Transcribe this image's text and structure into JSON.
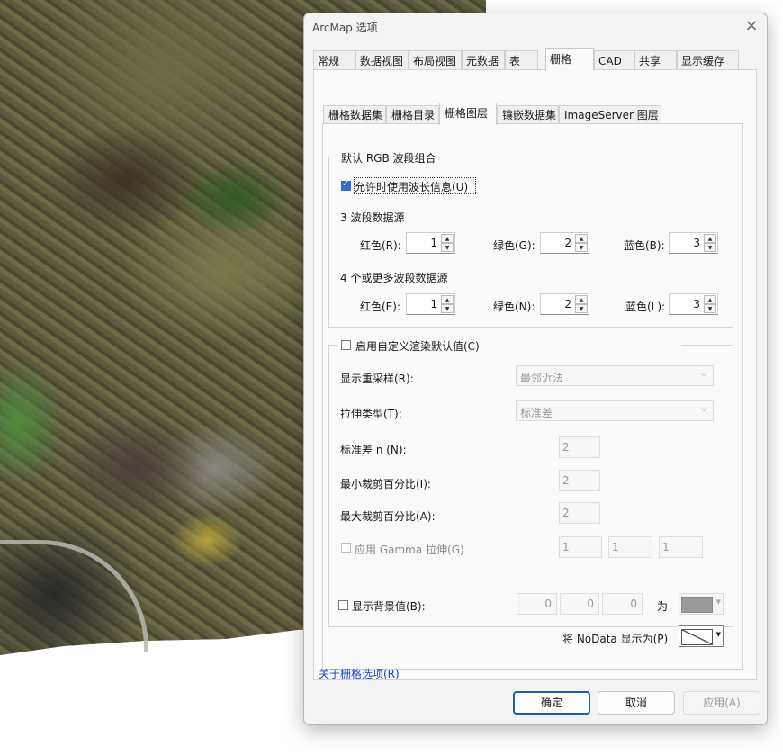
{
  "window": {
    "title": "ArcMap 选项"
  },
  "tabs": [
    "常规",
    "数据视图",
    "布局视图",
    "元数据",
    "表",
    "栅格",
    "CAD",
    "共享",
    "显示缓存"
  ],
  "subtabs": [
    "栅格数据集",
    "栅格目录",
    "栅格图层",
    "镶嵌数据集",
    "ImageServer 图层"
  ],
  "rgb_group": {
    "legend": "默认 RGB 波段组合",
    "use_wavelength": {
      "label": "允许时使用波长信息(U)",
      "checked": true
    },
    "three_band": {
      "heading": "3 波段数据源",
      "red_label": "红色(R):",
      "red": "1",
      "green_label": "绿色(G):",
      "green": "2",
      "blue_label": "蓝色(B):",
      "blue": "3"
    },
    "multi_band": {
      "heading": "4 个或更多波段数据源",
      "red_label": "红色(E):",
      "red": "1",
      "green_label": "绿色(N):",
      "green": "2",
      "blue_label": "蓝色(L):",
      "blue": "3"
    }
  },
  "render_group": {
    "legend": "启用自定义渲染默认值(C)",
    "checked": false,
    "resample_label": "显示重采样(R):",
    "resample_value": "最邻近法",
    "stretch_label": "拉伸类型(T):",
    "stretch_value": "标准差",
    "stddev_label": "标准差 n (N):",
    "stddev_value": "2",
    "min_clip_label": "最小裁剪百分比(I):",
    "min_clip_value": "2",
    "max_clip_label": "最大裁剪百分比(A):",
    "max_clip_value": "2",
    "gamma_label": "应用 Gamma 拉伸(G)",
    "gamma_values": [
      "1",
      "1",
      "1"
    ]
  },
  "background": {
    "label": "显示背景值(B):",
    "checked": false,
    "values": [
      "0",
      "0",
      "0"
    ],
    "as_label": "为",
    "nodata_label": "将 NoData 显示为(P)"
  },
  "help_link": "关于栅格选项(R)",
  "buttons": {
    "ok": "确定",
    "cancel": "取消",
    "apply": "应用(A)"
  }
}
